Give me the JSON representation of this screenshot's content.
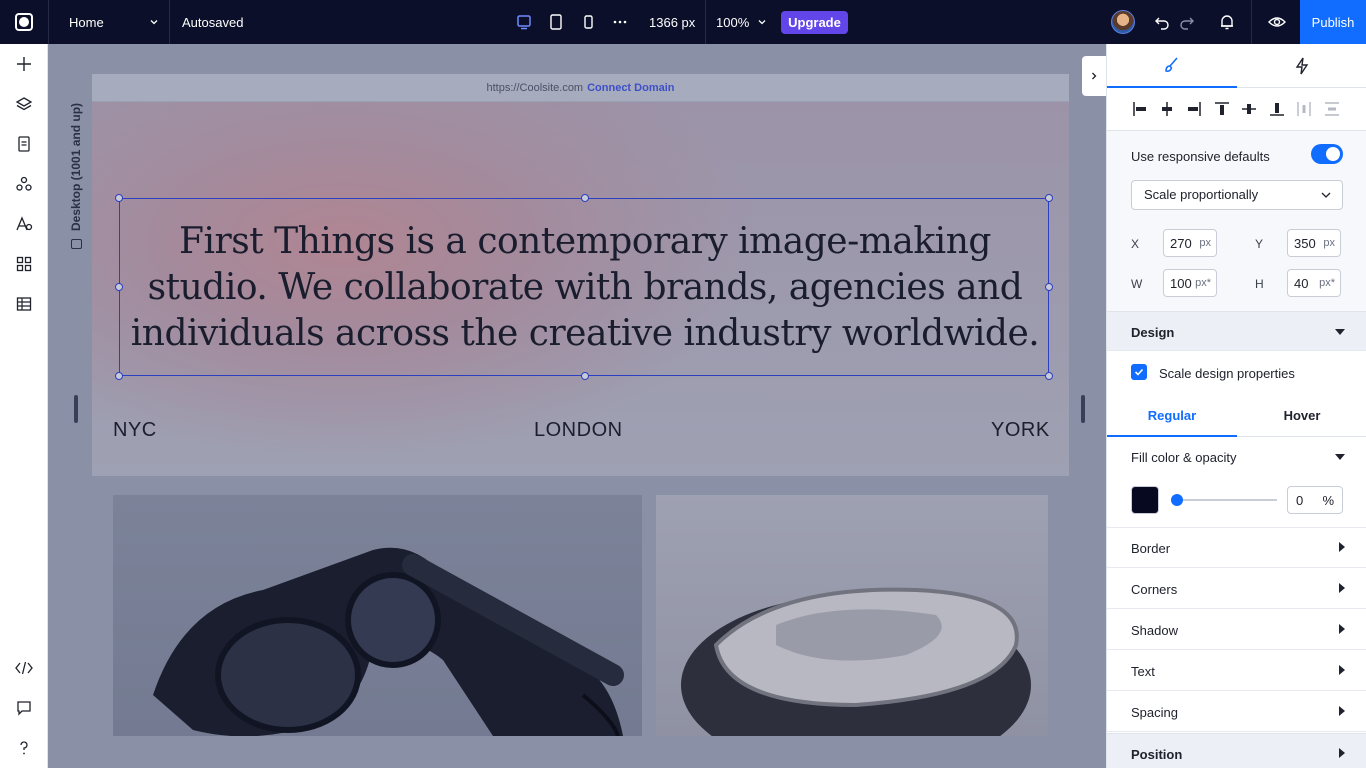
{
  "topbar": {
    "page_name": "Home",
    "autosave_status": "Autosaved",
    "viewport_width": "1366 px",
    "zoom": "100%",
    "upgrade_label": "Upgrade",
    "publish_label": "Publish",
    "device_icons": [
      "desktop-icon",
      "tablet-icon",
      "mobile-icon",
      "more-icon"
    ]
  },
  "leftbar": {
    "tools": [
      "add-icon",
      "layers-icon",
      "pages-icon",
      "components-icon",
      "text-styles-icon",
      "apps-icon",
      "table-icon"
    ],
    "bottom_tools": [
      "code-icon",
      "chat-icon",
      "help-icon"
    ]
  },
  "canvas": {
    "breakpoint_label": "Desktop (1001 and up)",
    "site_url": "https://Coolsite.com",
    "connect_domain": "Connect Domain",
    "hero_text": "First Things is a contemporary image-making studio. We collaborate with brands, agencies and individuals across the creative industry worldwide.",
    "cities": [
      "NYC",
      "LONDON",
      "YORK"
    ]
  },
  "panel": {
    "tabs": [
      "design-brush-icon",
      "interactions-bolt-icon"
    ],
    "responsive_label": "Use responsive defaults",
    "responsive_on": true,
    "scale_mode": "Scale proportionally",
    "x_label": "X",
    "x_value": "270",
    "x_unit": "px",
    "y_label": "Y",
    "y_value": "350",
    "y_unit": "px",
    "w_label": "W",
    "w_value": "100",
    "w_unit": "px*",
    "h_label": "H",
    "h_value": "40",
    "h_unit": "px*",
    "design_section": "Design",
    "scale_design_label": "Scale design properties",
    "state_regular": "Regular",
    "state_hover": "Hover",
    "fill_label": "Fill color & opacity",
    "fill_color": "#06091f",
    "opacity_value": "0",
    "opacity_unit": "%",
    "sections": [
      "Border",
      "Corners",
      "Shadow",
      "Text",
      "Spacing"
    ],
    "position_section": "Position"
  },
  "colors": {
    "accent": "#116dff",
    "upgrade": "#6246ea",
    "topbar": "#0b0f29"
  }
}
